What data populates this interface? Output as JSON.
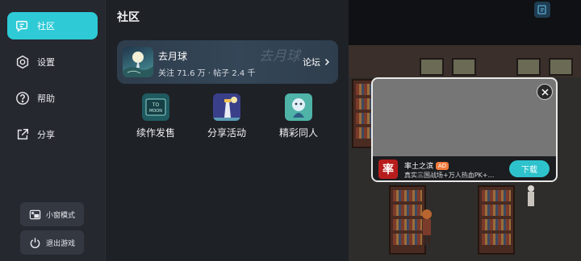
{
  "sidebar": {
    "items": [
      {
        "label": "社区",
        "icon": "chat-icon",
        "active": true
      },
      {
        "label": "设置",
        "icon": "settings-icon",
        "active": false
      },
      {
        "label": "帮助",
        "icon": "help-icon",
        "active": false
      },
      {
        "label": "分享",
        "icon": "share-icon",
        "active": false
      }
    ],
    "mini_window_label": "小窗模式",
    "exit_game_label": "退出游戏"
  },
  "panel": {
    "title": "社区",
    "banner": {
      "name": "去月球",
      "stats": "关注 71.6 万 · 帖子 2.4 千",
      "watermark": "去月球",
      "forum_label": "论坛"
    },
    "features": [
      {
        "label": "续作发售",
        "icon": "to-the-moon-icon"
      },
      {
        "label": "分享活动",
        "icon": "lighthouse-icon"
      },
      {
        "label": "精彩同人",
        "icon": "fanart-icon"
      }
    ]
  },
  "ad": {
    "app_icon_text": "率",
    "app_name": "率土之滨",
    "badge": "AD",
    "description": "真实三国战场+万人热血PK+…",
    "download_label": "下载"
  },
  "colors": {
    "accent": "#2ecad6",
    "sidebar_bg": "#25282e",
    "panel_bg": "#1e2126",
    "download_button": "#2ec3cc",
    "ad_badge": "#f07c3c"
  }
}
